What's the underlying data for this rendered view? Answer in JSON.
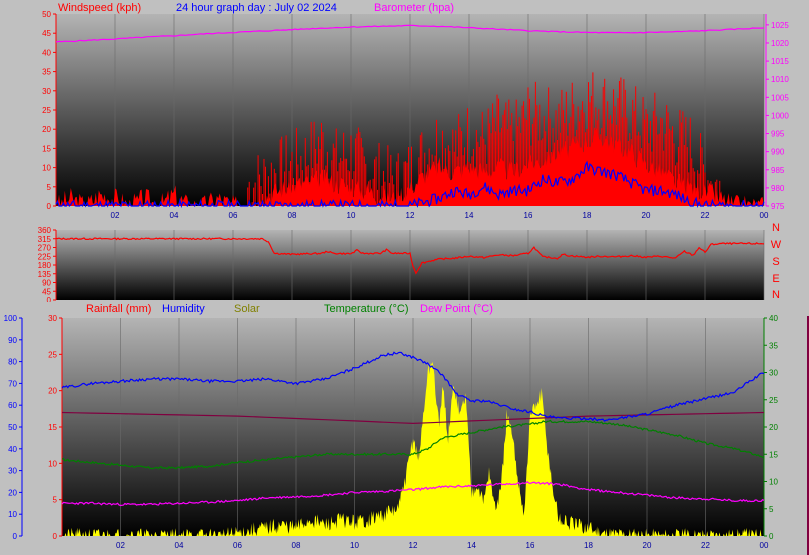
{
  "header": {
    "title": "24 hour graph day : July 02 2024",
    "wind_label": "Windspeed (kph)",
    "baro_label": "Barometer (hpa)"
  },
  "bottom_legend": {
    "rain": "Rainfall (mm)",
    "humidity": "Humidity",
    "solar": "Solar",
    "temperature": "Temperature (°C)",
    "dewpoint": "Dew Point (°C)"
  },
  "compass": [
    "N",
    "W",
    "S",
    "E",
    "N"
  ],
  "colors": {
    "wind": "#ff0000",
    "gust_avg": "#0000ff",
    "barometer": "#ff00ff",
    "direction": "#ff0000",
    "rain": "#800040",
    "humidity": "#0000ff",
    "solar": "#ffff00",
    "temperature": "#008000",
    "dewpoint": "#ff00ff"
  },
  "chart_data": [
    {
      "type": "line",
      "title": "24 hour graph day : July 02 2024",
      "x_ticks": [
        "02",
        "04",
        "06",
        "08",
        "10",
        "12",
        "14",
        "16",
        "18",
        "20",
        "22",
        "00"
      ],
      "xlim": [
        0,
        24
      ],
      "y_left": {
        "label": "Windspeed (kph)",
        "ylim": [
          0,
          50
        ],
        "ticks": [
          0,
          5,
          10,
          15,
          20,
          25,
          30,
          35,
          40,
          45,
          50
        ]
      },
      "y_right": {
        "label": "Barometer (hpa)",
        "ylim": [
          975,
          1028
        ],
        "ticks": [
          975,
          980,
          985,
          990,
          995,
          1000,
          1005,
          1010,
          1015,
          1020,
          1025
        ]
      },
      "series": [
        {
          "name": "Windspeed (kph)",
          "axis": "left",
          "x": [
            0,
            0.5,
            1,
            1.5,
            2,
            2.5,
            3,
            3.5,
            4,
            4.5,
            5,
            5.5,
            6,
            6.5,
            7,
            7.5,
            8,
            8.5,
            9,
            9.5,
            10,
            10.5,
            11,
            11.5,
            12,
            12.5,
            13,
            13.5,
            14,
            14.5,
            15,
            15.5,
            16,
            16.5,
            17,
            17.5,
            18,
            18.5,
            19,
            19.5,
            20,
            20.5,
            21,
            21.5,
            22,
            22.5,
            23,
            23.5,
            24
          ],
          "values": [
            0,
            2,
            0,
            3,
            2,
            0,
            2,
            0,
            3,
            0,
            0,
            2,
            0,
            0,
            2,
            4,
            5,
            6,
            7,
            6,
            5,
            4,
            3,
            2,
            5,
            8,
            10,
            9,
            10,
            9,
            10,
            9,
            11,
            12,
            14,
            15,
            17,
            18,
            16,
            14,
            11,
            9,
            6,
            5,
            4,
            2,
            0,
            0,
            0
          ]
        },
        {
          "name": "Gust (kph)",
          "axis": "left",
          "x": [
            6.5,
            7,
            7.5,
            8,
            8.5,
            9,
            9.5,
            10,
            10.5,
            11,
            11.5,
            12,
            12.5,
            13,
            13.5,
            14,
            14.5,
            15,
            15.5,
            16,
            16.5,
            17,
            17.5,
            18,
            18.5,
            19,
            19.5,
            20,
            20.5,
            21,
            21.5,
            22,
            22.5
          ],
          "values": [
            5,
            7,
            9,
            11,
            13,
            17,
            12,
            14,
            10,
            8,
            6,
            9,
            14,
            18,
            15,
            19,
            17,
            21,
            18,
            24,
            23,
            22,
            25,
            28,
            27,
            26,
            24,
            20,
            22,
            18,
            16,
            8,
            5
          ]
        },
        {
          "name": "Average (kph)",
          "axis": "left",
          "x": [
            0,
            12,
            12.5,
            13,
            13.5,
            14,
            14.5,
            15,
            15.5,
            16,
            16.5,
            17,
            17.5,
            18,
            18.5,
            19,
            19.5,
            20,
            20.5,
            21,
            21.5,
            22,
            23,
            24
          ],
          "values": [
            0,
            0,
            1,
            2,
            4,
            3,
            5,
            3,
            4,
            4,
            7,
            6,
            7,
            10,
            9,
            8,
            6,
            4,
            4,
            3,
            1,
            0,
            0,
            0
          ]
        },
        {
          "name": "Barometer (hpa)",
          "axis": "right",
          "x": [
            0,
            1,
            2,
            3,
            4,
            5,
            6,
            7,
            8,
            9,
            10,
            11,
            12,
            13,
            14,
            15,
            16,
            17,
            18,
            19,
            20,
            21,
            22,
            23,
            24
          ],
          "values": [
            1020.3,
            1020.7,
            1021.1,
            1021.6,
            1022.0,
            1022.5,
            1022.9,
            1023.3,
            1023.7,
            1024.1,
            1024.4,
            1024.6,
            1024.8,
            1024.6,
            1024.2,
            1023.8,
            1023.4,
            1023.1,
            1022.9,
            1022.8,
            1022.9,
            1023.1,
            1023.4,
            1023.8,
            1024.2
          ]
        }
      ]
    },
    {
      "type": "line",
      "x_ticks": [
        "02",
        "04",
        "06",
        "08",
        "10",
        "12",
        "14",
        "16",
        "18",
        "20",
        "22",
        "00"
      ],
      "xlim": [
        0,
        24
      ],
      "y_left": {
        "ylim": [
          0,
          360
        ],
        "ticks": [
          0,
          45,
          90,
          135,
          180,
          225,
          270,
          315,
          360
        ]
      },
      "series": [
        {
          "name": "Wind direction",
          "axis": "left",
          "x": [
            0,
            1,
            2,
            3,
            4,
            5,
            6,
            7,
            7.2,
            7.4,
            8,
            9,
            9.2,
            9.4,
            10,
            10.2,
            10.4,
            11,
            11.2,
            11.4,
            12,
            12.1,
            12.2,
            12.4,
            12.8,
            13,
            13.5,
            14,
            14.5,
            15,
            15.5,
            16,
            16.2,
            16.5,
            17,
            17.2,
            17.4,
            18,
            18.5,
            19,
            19.5,
            20,
            20.5,
            21,
            21.3,
            21.6,
            21.8,
            22,
            22.2,
            22.5,
            23,
            24
          ],
          "values": [
            315,
            315,
            315,
            315,
            315,
            315,
            315,
            315,
            300,
            240,
            235,
            240,
            250,
            240,
            238,
            255,
            240,
            240,
            258,
            240,
            240,
            175,
            140,
            190,
            205,
            210,
            215,
            225,
            218,
            232,
            228,
            240,
            270,
            222,
            215,
            235,
            228,
            220,
            225,
            222,
            228,
            220,
            225,
            215,
            250,
            230,
            270,
            245,
            285,
            290,
            290,
            290
          ]
        }
      ]
    },
    {
      "type": "area",
      "x_ticks": [
        "02",
        "04",
        "06",
        "08",
        "10",
        "12",
        "14",
        "16",
        "18",
        "20",
        "22",
        "00"
      ],
      "xlim": [
        0,
        24
      ],
      "y_left": {
        "label": "Humidity",
        "ylim": [
          0,
          100
        ],
        "ticks": [
          0,
          10,
          20,
          30,
          40,
          50,
          60,
          70,
          80,
          90,
          100
        ]
      },
      "y_mid": {
        "label": "Rainfall (mm)",
        "ylim": [
          0,
          30
        ],
        "ticks": [
          0,
          5,
          10,
          15,
          20,
          25,
          30
        ]
      },
      "y_right": {
        "label": "Temperature (°C)",
        "ylim": [
          0,
          40
        ],
        "ticks": [
          0,
          5,
          10,
          15,
          20,
          25,
          30,
          35,
          40
        ]
      },
      "series": [
        {
          "name": "Humidity",
          "axis": "left",
          "x": [
            0,
            1,
            2,
            3,
            4,
            5,
            6,
            7,
            8,
            9,
            10,
            11,
            11.5,
            12,
            12.5,
            13,
            13.5,
            14,
            14.5,
            15,
            15.5,
            16,
            16.5,
            17,
            17.5,
            18,
            18.5,
            19,
            20,
            21,
            22,
            23,
            23.5,
            24
          ],
          "values": [
            68,
            70,
            71,
            72,
            72,
            71,
            71,
            72,
            70,
            72,
            77,
            83,
            84,
            82,
            79,
            74,
            65,
            62,
            62,
            60,
            58,
            57,
            55,
            54,
            54,
            54,
            53,
            54,
            56,
            60,
            63,
            66,
            71,
            75
          ]
        },
        {
          "name": "Rainfall (mm)",
          "axis": "mid",
          "x": [
            0,
            6,
            12,
            18,
            24
          ],
          "values": [
            17,
            16.5,
            15.5,
            16.5,
            17
          ]
        },
        {
          "name": "Solar",
          "axis": "right",
          "x": [
            0,
            5.5,
            6,
            6.5,
            7,
            7.5,
            8,
            8.5,
            9,
            9.5,
            10,
            10.5,
            11,
            11.5,
            11.8,
            12,
            12.2,
            12.5,
            12.7,
            12.8,
            12.9,
            13,
            13.2,
            13.4,
            13.6,
            13.8,
            14,
            14.2,
            14.4,
            14.6,
            14.8,
            15,
            15.2,
            15.4,
            15.6,
            15.8,
            16,
            16.2,
            16.4,
            16.6,
            16.8,
            17,
            17.5,
            18,
            18.5,
            19,
            19.5,
            20,
            21,
            22,
            24
          ],
          "values": [
            0,
            0,
            0.5,
            1,
            1.5,
            2,
            1.5,
            3,
            2,
            3,
            2.5,
            3,
            4,
            5,
            12,
            18,
            14,
            30,
            32,
            24,
            20,
            28,
            18,
            28,
            22,
            26,
            8,
            10,
            6,
            12,
            5,
            8,
            22,
            18,
            10,
            4,
            22,
            24,
            26,
            16,
            8,
            3,
            2,
            1.5,
            0.5,
            0.3,
            0.2,
            0,
            0,
            0,
            0
          ]
        },
        {
          "name": "Temperature (°C)",
          "axis": "right",
          "x": [
            0,
            1,
            2,
            3,
            4,
            5,
            6,
            7,
            8,
            9,
            10,
            11,
            12,
            12.5,
            13,
            14,
            15,
            16,
            16.5,
            17,
            18,
            19,
            20,
            21,
            22,
            23,
            24
          ],
          "values": [
            14,
            13.5,
            13,
            12.5,
            12.5,
            12.8,
            13.5,
            14,
            14.5,
            15,
            15,
            15,
            15,
            16,
            18,
            19,
            20,
            20.5,
            21,
            21,
            21,
            20.5,
            19.5,
            18.5,
            17,
            16,
            14.5
          ]
        },
        {
          "name": "Dew Point (°C)",
          "axis": "right",
          "x": [
            0,
            1,
            2,
            3,
            4,
            5,
            6,
            7,
            8,
            9,
            10,
            11,
            12,
            13,
            14,
            15,
            16,
            17,
            18,
            19,
            20,
            21,
            22,
            23,
            24
          ],
          "values": [
            6,
            6,
            5.8,
            5.8,
            6,
            6.2,
            6.5,
            7,
            7.2,
            7.5,
            8,
            8.2,
            8.5,
            9,
            9.2,
            9.5,
            9.8,
            9.5,
            8.5,
            8,
            7.5,
            7,
            6.8,
            6.5,
            6.5
          ]
        }
      ]
    }
  ]
}
